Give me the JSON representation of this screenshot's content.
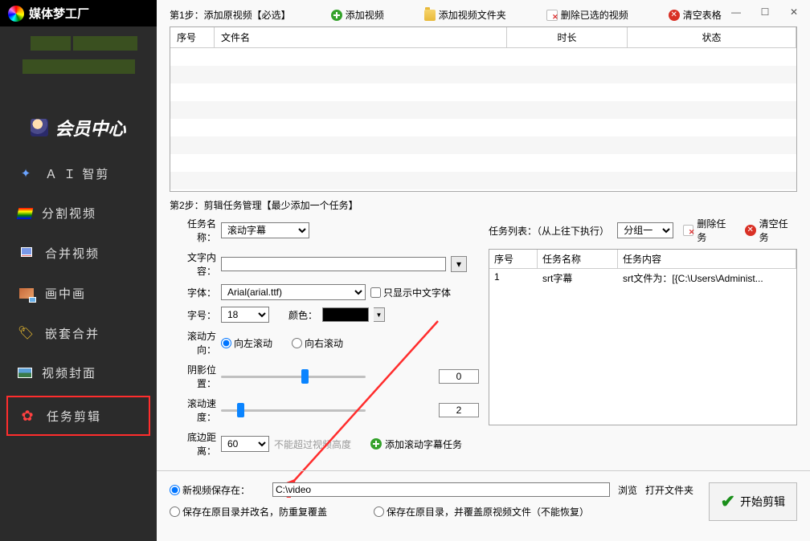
{
  "app": {
    "title": "媒体梦工厂"
  },
  "win": {
    "min": "—",
    "max": "☐",
    "close": "✕"
  },
  "memberCenter": "会员中心",
  "nav": [
    {
      "icon": "ai",
      "label": "Ａ Ｉ 智剪"
    },
    {
      "icon": "split",
      "label": "分割视频"
    },
    {
      "icon": "merge",
      "label": "合并视频"
    },
    {
      "icon": "pip",
      "label": "画中画"
    },
    {
      "icon": "nest",
      "label": "嵌套合并"
    },
    {
      "icon": "cover",
      "label": "视频封面"
    },
    {
      "icon": "task",
      "label": "任务剪辑"
    }
  ],
  "step1": {
    "label": "第1步：添加原视频【必选】",
    "addVideo": "添加视频",
    "addFolder": "添加视频文件夹",
    "delSelected": "删除已选的视频",
    "clear": "清空表格",
    "cols": {
      "idx": "序号",
      "name": "文件名",
      "dur": "时长",
      "stat": "状态"
    }
  },
  "step2": {
    "label": "第2步：剪辑任务管理【最少添加一个任务】",
    "taskNameLabel": "任务名称：",
    "taskNameValue": "滚动字幕",
    "textLabel": "文字内容：",
    "textValue": "",
    "fontLabel": "字体：",
    "fontValue": "Arial(arial.ttf)",
    "onlyCN": "只显示中文字体",
    "sizeLabel": "字号：",
    "sizeValue": "18",
    "colorLabel": "颜色：",
    "dirLabel": "滚动方向：",
    "dirLeft": "向左滚动",
    "dirRight": "向右滚动",
    "shadowLabel": "阴影位置：",
    "shadowValue": "0",
    "speedLabel": "滚动速度：",
    "speedValue": "2",
    "bottomLabel": "底边距离：",
    "bottomValue": "60",
    "bottomHint": "不能超过视频高度",
    "addScrollTask": "添加滚动字幕任务",
    "taskListLabel": "任务列表：（从上往下执行）",
    "groupValue": "分组一",
    "delTask": "删除任务",
    "clearTask": "清空任务",
    "tcols": {
      "idx": "序号",
      "name": "任务名称",
      "content": "任务内容"
    },
    "tasks": [
      {
        "idx": "1",
        "name": "srt字幕",
        "content": "srt文件为：[{C:\\Users\\Administ..."
      }
    ]
  },
  "footer": {
    "saveOpt1": "新视频保存在：",
    "savePath": "C:\\video",
    "browse": "浏览",
    "openFolder": "打开文件夹",
    "saveOpt2": "保存在原目录并改名，防重复覆盖",
    "saveOpt3": "保存在原目录，并覆盖原视频文件（不能恢复）",
    "start": "开始剪辑"
  }
}
